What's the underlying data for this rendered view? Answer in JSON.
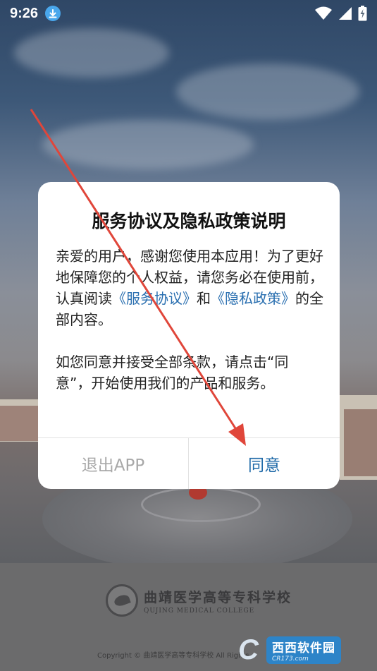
{
  "status_bar": {
    "time": "9:26",
    "icons": [
      "download-icon",
      "wifi-icon",
      "signal-icon",
      "battery-charging-icon"
    ]
  },
  "dialog": {
    "title": "服务协议及隐私政策说明",
    "para1_part1": "亲爱的用户，感谢您使用本应用！为了更好地保障您的个人权益，请您务必在使用前，认真阅读",
    "link_service": "《服务协议》",
    "para1_and": "和",
    "link_privacy": "《隐私政策》",
    "para1_part2": "的全部内容。",
    "para2": "如您同意并接受全部条款，请点击“同意”，开始使用我们的产品和服务。",
    "exit_label": "退出APP",
    "agree_label": "同意",
    "colors": {
      "link": "#2a6fb0",
      "agree": "#1f6aa8",
      "exit": "#a8a8a8"
    }
  },
  "footer": {
    "school_cn": "曲靖医学高等专科学校",
    "school_en": "QUJING MEDICAL COLLEGE",
    "copyright": "Copyright © 曲靖医学高等专科学校 All Rights"
  },
  "watermark": {
    "logo_letter": "C",
    "cn": "西西软件园",
    "en": "CR173.com"
  },
  "annotation": {
    "arrow_color": "#e0463a"
  }
}
